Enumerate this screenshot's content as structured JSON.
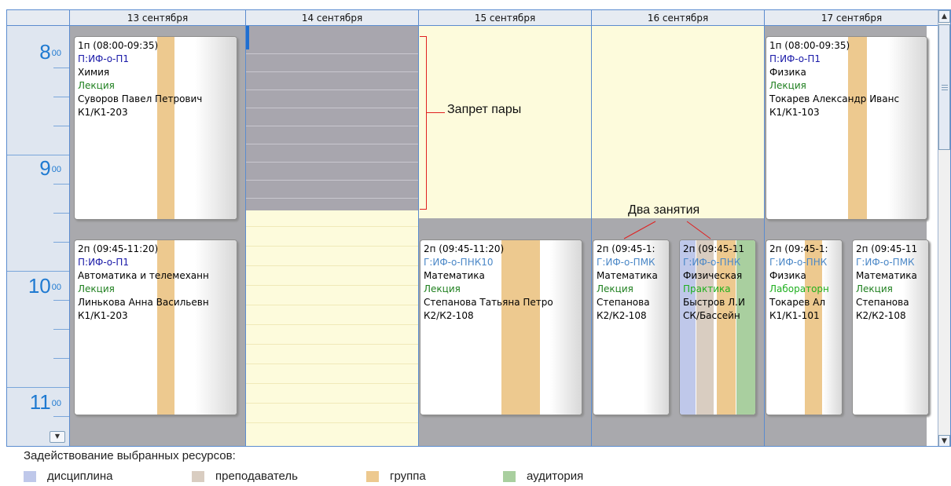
{
  "colors": {
    "accent": "#1f7ad1",
    "border": "#5b8ccf",
    "forbidden": "#a8a6ae",
    "free_bg": "#fdfbdc",
    "discipline": "#bfc8ea",
    "teacher": "#d9cdc1",
    "group": "#edc98f",
    "room": "#a9cf9f"
  },
  "days": [
    "13 сентября",
    "14 сентября",
    "15 сентября",
    "16 сентября",
    "17 сентября"
  ],
  "hours": [
    {
      "h": "8",
      "m": "00"
    },
    {
      "h": "9",
      "m": "00"
    },
    {
      "h": "10",
      "m": "00"
    },
    {
      "h": "11",
      "m": "00"
    }
  ],
  "annotations": {
    "forbid": "Запрет пары",
    "two_lessons": "Два занятия"
  },
  "lessons": [
    {
      "time": "1п (08:00-09:35)",
      "group": "П:ИФ-о-П1",
      "subject": "Химия",
      "type": "Лекция",
      "teacher": "Суворов Павел Петрович",
      "room": "К1/К1-203"
    },
    {
      "time": "1п (08:00-09:35)",
      "group": "П:ИФ-о-П1",
      "subject": "Физика",
      "type": "Лекция",
      "teacher": "Токарев Александр Иванс",
      "room": "К1/К1-103"
    },
    {
      "time": "2п (09:45-11:20)",
      "group": "П:ИФ-о-П1",
      "subject": "Автоматика и телемеханн",
      "type": "Лекция",
      "teacher": "Линькова Анна Васильевн",
      "room": "К1/К1-203"
    },
    {
      "time": "2п (09:45-11:20)",
      "group": "Г:ИФ-о-ПНК10",
      "subject": "Математика",
      "type": "Лекция",
      "teacher": "Степанова Татьяна Петро",
      "room": "К2/К2-108"
    },
    {
      "time": "2п (09:45-1:",
      "group": "Г:ИФ-о-ПМК",
      "subject": "Математика",
      "type": "Лекция",
      "teacher": "Степанова",
      "room": "К2/К2-108"
    },
    {
      "time": "2п (09:45-11",
      "group": "Г:ИФ-о-ПНК",
      "subject": "Физическая",
      "type": "Практика",
      "teacher": "Быстров Л.И",
      "room": "СК/Бассейн"
    },
    {
      "time": "2п (09:45-1:",
      "group": "Г:ИФ-о-ПНК",
      "subject": "Физика",
      "type": "Лабораторн",
      "teacher": "Токарев Ал",
      "room": "К1/К1-101"
    },
    {
      "time": "2п (09:45-11",
      "group": "Г:ИФ-о-ПМК",
      "subject": "Математика",
      "type": "Лекция",
      "teacher": "Степанова",
      "room": "К2/К2-108"
    }
  ],
  "legend": {
    "title": "Задействование выбранных ресурсов:",
    "items": [
      "дисциплина",
      "преподаватель",
      "группа",
      "аудитория"
    ]
  },
  "scroll": {
    "up_icon": "arrow-up-icon",
    "down_icon": "arrow-down-icon",
    "time_down_icon": "chevron-down-icon"
  }
}
